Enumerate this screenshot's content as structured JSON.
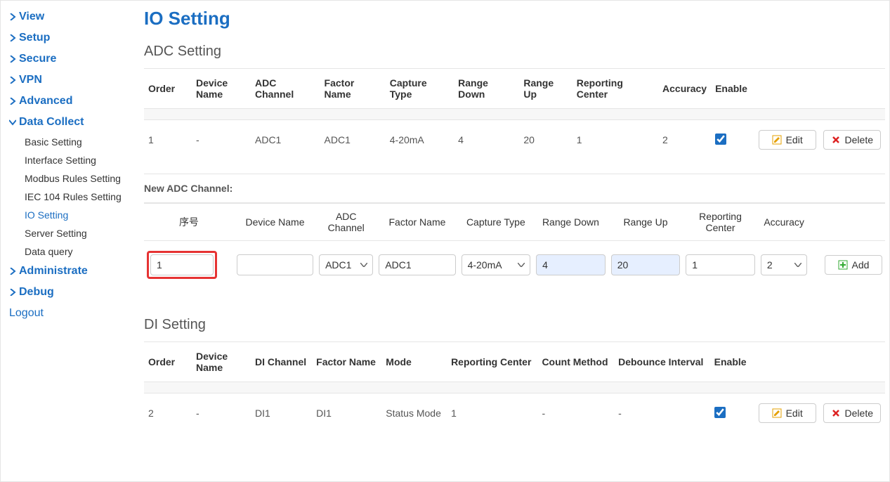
{
  "sidebar": {
    "items": [
      {
        "label": "View",
        "expanded": false
      },
      {
        "label": "Setup",
        "expanded": false
      },
      {
        "label": "Secure",
        "expanded": false
      },
      {
        "label": "VPN",
        "expanded": false
      },
      {
        "label": "Advanced",
        "expanded": false
      },
      {
        "label": "Data Collect",
        "expanded": true
      },
      {
        "label": "Administrate",
        "expanded": false
      },
      {
        "label": "Debug",
        "expanded": false
      }
    ],
    "data_collect_sub": [
      {
        "label": "Basic Setting"
      },
      {
        "label": "Interface Setting"
      },
      {
        "label": "Modbus Rules Setting"
      },
      {
        "label": "IEC 104 Rules Setting"
      },
      {
        "label": "IO Setting",
        "active": true
      },
      {
        "label": "Server Setting"
      },
      {
        "label": "Data query"
      }
    ],
    "logout": "Logout"
  },
  "page": {
    "title": "IO Setting"
  },
  "adc": {
    "title": "ADC Setting",
    "headers": {
      "order": "Order",
      "device_name": "Device Name",
      "adc_channel": "ADC Channel",
      "factor_name": "Factor Name",
      "capture_type": "Capture Type",
      "range_down": "Range Down",
      "range_up": "Range Up",
      "reporting_center": "Reporting Center",
      "accuracy": "Accuracy",
      "enable": "Enable"
    },
    "rows": [
      {
        "order": "1",
        "device_name": "-",
        "adc_channel": "ADC1",
        "factor_name": "ADC1",
        "capture_type": "4-20mA",
        "range_down": "4",
        "range_up": "20",
        "reporting_center": "1",
        "accuracy": "2",
        "enable": true
      }
    ],
    "buttons": {
      "edit": "Edit",
      "delete": "Delete",
      "add": "Add"
    }
  },
  "new_adc": {
    "title": "New ADC Channel:",
    "headers": {
      "order": "序号",
      "device_name": "Device Name",
      "adc_channel": "ADC Channel",
      "factor_name": "Factor Name",
      "capture_type": "Capture Type",
      "range_down": "Range Down",
      "range_up": "Range Up",
      "reporting_center": "Reporting Center",
      "accuracy": "Accuracy"
    },
    "values": {
      "order": "1",
      "device_name": "",
      "adc_channel": "ADC1",
      "factor_name": "ADC1",
      "capture_type": "4-20mA",
      "range_down": "4",
      "range_up": "20",
      "reporting_center": "1",
      "accuracy": "2"
    }
  },
  "di": {
    "title": "DI Setting",
    "headers": {
      "order": "Order",
      "device_name": "Device Name",
      "di_channel": "DI Channel",
      "factor_name": "Factor Name",
      "mode": "Mode",
      "reporting_center": "Reporting Center",
      "count_method": "Count Method",
      "debounce_interval": "Debounce Interval",
      "enable": "Enable"
    },
    "rows": [
      {
        "order": "2",
        "device_name": "-",
        "di_channel": "DI1",
        "factor_name": "DI1",
        "mode": "Status Mode",
        "reporting_center": "1",
        "count_method": "-",
        "debounce_interval": "-",
        "enable": true
      }
    ],
    "buttons": {
      "edit": "Edit",
      "delete": "Delete"
    }
  }
}
